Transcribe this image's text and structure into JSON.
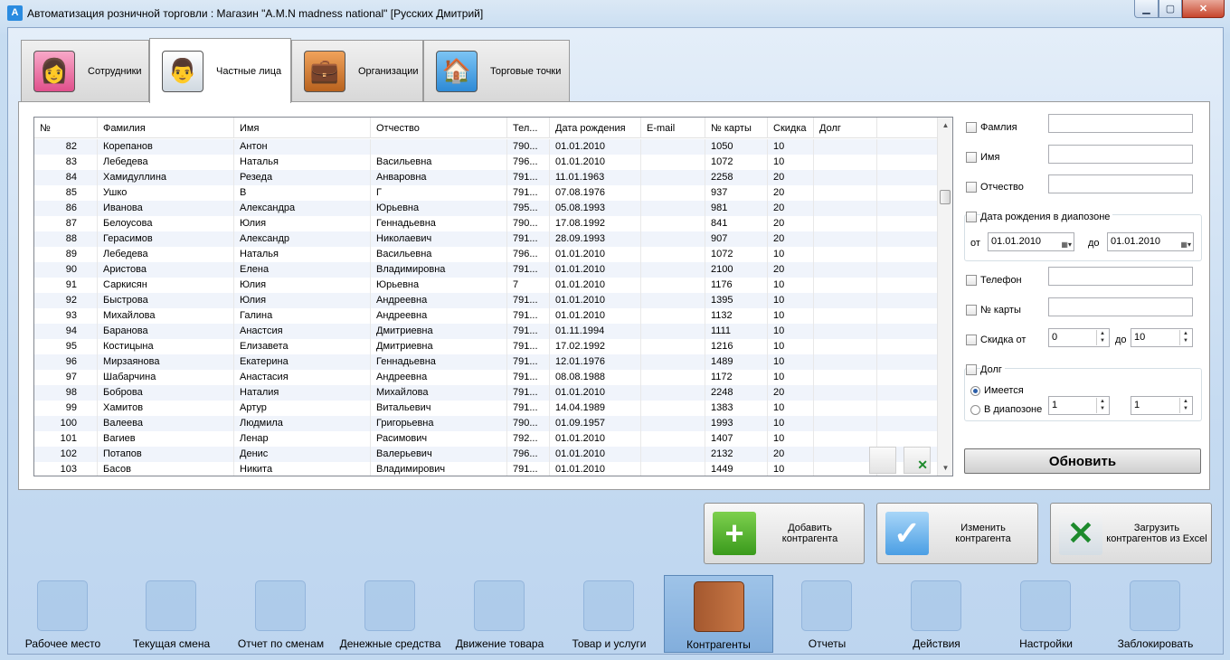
{
  "window": {
    "title": "Автоматизация розничной торговли : Магазин \"A.M.N madness national\" [Русских Дмитрий]",
    "app_icon": "А"
  },
  "tabs": [
    {
      "label": "Сотрудники",
      "icon": "employee-icon"
    },
    {
      "label": "Частные лица",
      "icon": "person-icon",
      "active": true
    },
    {
      "label": "Организации",
      "icon": "briefcase-icon"
    },
    {
      "label": "Торговые точки",
      "icon": "shop-icon"
    }
  ],
  "grid": {
    "columns": [
      "№",
      "Фамилия",
      "Имя",
      "Отчество",
      "Тел...",
      "Дата рождения",
      "E-mail",
      "№ карты",
      "Скидка",
      "Долг"
    ],
    "rows": [
      [
        "82",
        "Корепанов",
        "Антон",
        "",
        "790...",
        "01.01.2010",
        "",
        "1050",
        "10",
        ""
      ],
      [
        "83",
        "Лебедева",
        "Наталья",
        "Васильевна",
        "796...",
        "01.01.2010",
        "",
        "1072",
        "10",
        ""
      ],
      [
        "84",
        "Хамидуллина",
        "Резеда",
        "Анваровна",
        "791...",
        "11.01.1963",
        "",
        "2258",
        "20",
        ""
      ],
      [
        "85",
        "Ушко",
        "В",
        "Г",
        "791...",
        "07.08.1976",
        "",
        "937",
        "20",
        ""
      ],
      [
        "86",
        "Иванова",
        "Александра",
        "Юрьевна",
        "795...",
        "05.08.1993",
        "",
        "981",
        "20",
        ""
      ],
      [
        "87",
        "Белоусова",
        "Юлия",
        "Геннадьевна",
        "790...",
        "17.08.1992",
        "",
        "841",
        "20",
        ""
      ],
      [
        "88",
        "Герасимов",
        "Александр",
        "Николаевич",
        "791...",
        "28.09.1993",
        "",
        "907",
        "20",
        ""
      ],
      [
        "89",
        "Лебедева",
        "Наталья",
        "Васильевна",
        "796...",
        "01.01.2010",
        "",
        "1072",
        "10",
        ""
      ],
      [
        "90",
        "Аристова",
        "Елена",
        "Владимировна",
        "791...",
        "01.01.2010",
        "",
        "2100",
        "20",
        ""
      ],
      [
        "91",
        "Саркисян",
        "Юлия",
        "Юрьевна",
        "7",
        "01.01.2010",
        "",
        "1176",
        "10",
        ""
      ],
      [
        "92",
        "Быстрова",
        "Юлия",
        "Андреевна",
        "791...",
        "01.01.2010",
        "",
        "1395",
        "10",
        ""
      ],
      [
        "93",
        "Михайлова",
        "Галина",
        "Андреевна",
        "791...",
        "01.01.2010",
        "",
        "1132",
        "10",
        ""
      ],
      [
        "94",
        "Баранова",
        "Анастсия",
        "Дмитриевна",
        "791...",
        "01.11.1994",
        "",
        "1111",
        "10",
        ""
      ],
      [
        "95",
        "Костицына",
        "Елизавета",
        "Дмитриевна",
        "791...",
        "17.02.1992",
        "",
        "1216",
        "10",
        ""
      ],
      [
        "96",
        "Мирзаянова",
        "Екатерина",
        "Геннадьевна",
        "791...",
        "12.01.1976",
        "",
        "1489",
        "10",
        ""
      ],
      [
        "97",
        "Шабарчина",
        "Анастасия",
        "Андреевна",
        "791...",
        "08.08.1988",
        "",
        "1172",
        "10",
        ""
      ],
      [
        "98",
        "Боброва",
        "Наталия",
        "Михайлова",
        "791...",
        "01.01.2010",
        "",
        "2248",
        "20",
        ""
      ],
      [
        "99",
        "Хамитов",
        "Артур",
        "Витальевич",
        "791...",
        "14.04.1989",
        "",
        "1383",
        "10",
        ""
      ],
      [
        "100",
        "Валеева",
        "Людмила",
        "Григорьевна",
        "790...",
        "01.09.1957",
        "",
        "1993",
        "10",
        ""
      ],
      [
        "101",
        "Вагиев",
        "Ленар",
        "Расимович",
        "792...",
        "01.01.2010",
        "",
        "1407",
        "10",
        ""
      ],
      [
        "102",
        "Потапов",
        "Денис",
        "Валерьевич",
        "796...",
        "01.01.2010",
        "",
        "2132",
        "20",
        ""
      ],
      [
        "103",
        "Басов",
        "Никита",
        "Владимирович",
        "791...",
        "01.01.2010",
        "",
        "1449",
        "10",
        ""
      ]
    ]
  },
  "filters": {
    "surname": "Фамлия",
    "name": "Имя",
    "patronymic": "Отчество",
    "birth_range": "Дата рождения в диапозоне",
    "from": "от",
    "to": "до",
    "date_from": "01.01.2010",
    "date_to": "01.01.2010",
    "phone": "Телефон",
    "card": "№ карты",
    "discount_from": "Скидка от",
    "discount_to": "до",
    "discount_from_value": "0",
    "discount_to_value": "10",
    "debt": "Долг",
    "debt_has": "Имеется",
    "debt_range": "В диапозоне",
    "debt_from_value": "1",
    "debt_to_value": "1",
    "refresh": "Обновить"
  },
  "actions": [
    {
      "label": "Добавить контрагента",
      "icon": "plus-icon"
    },
    {
      "label": "Изменить контрагента",
      "icon": "checkmark-icon"
    },
    {
      "label": "Загрузить контрагентов из Excel",
      "icon": "excel-icon"
    }
  ],
  "nav": [
    {
      "label": "Рабочее место",
      "icon": "cash-register-icon"
    },
    {
      "label": "Текущая смена",
      "icon": "notepad-icon"
    },
    {
      "label": "Отчет по сменам",
      "icon": "binder-icon"
    },
    {
      "label": "Денежные средства",
      "icon": "safe-icon"
    },
    {
      "label": "Движение товара",
      "icon": "document-icon"
    },
    {
      "label": "Товар и услуги",
      "icon": "box-icon"
    },
    {
      "label": "Контрагенты",
      "icon": "phonebook-icon",
      "active": true
    },
    {
      "label": "Отчеты",
      "icon": "tray-icon"
    },
    {
      "label": "Действия",
      "icon": "ruler-pencil-icon"
    },
    {
      "label": "Настройки",
      "icon": "settings-icon"
    },
    {
      "label": "Заблокировать",
      "icon": "lock-icon"
    }
  ]
}
